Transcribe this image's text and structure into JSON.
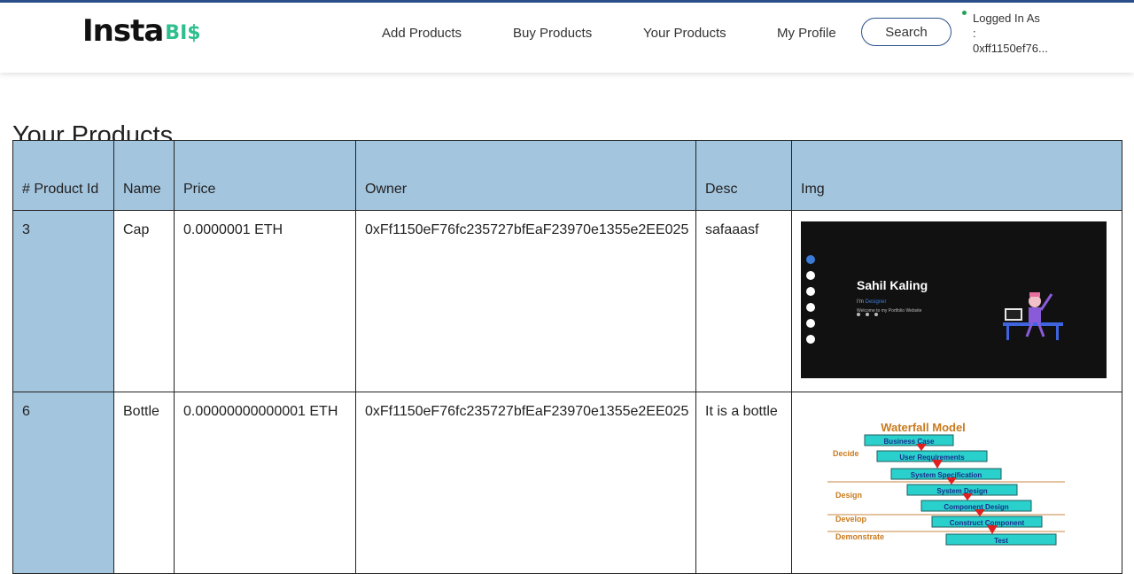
{
  "brand": {
    "main": "Insta",
    "sub": "BI$"
  },
  "nav": {
    "links": [
      "Add Products",
      "Buy Products",
      "Your Products",
      "My Profile"
    ],
    "search_label": "Search",
    "logged_in_lines": [
      "Logged In As",
      ":",
      "0xff1150ef76..."
    ]
  },
  "page": {
    "title": "Your Products"
  },
  "table": {
    "headers": [
      "# Product Id",
      "Name",
      "Price",
      "Owner",
      "Desc",
      "Img"
    ],
    "rows": [
      {
        "id": "3",
        "name": "Cap",
        "price": "0.0000001 ETH",
        "owner": "0xFf1150eF76fc235727bfEaF23970e1355e2EE025",
        "desc": "safaaasf"
      },
      {
        "id": "6",
        "name": "Bottle",
        "price": "0.00000000000001 ETH",
        "owner": "0xFf1150eF76fc235727bfEaF23970e1355e2EE025",
        "desc": "It is a bottle"
      }
    ]
  },
  "images": {
    "portfolio": {
      "name": "Sahil Kaling",
      "role_prefix": "I'm",
      "role": "Designer",
      "tagline": "Welcome to my Portfolio Website"
    },
    "waterfall": {
      "title": "Waterfall Model",
      "steps": [
        "Business Case",
        "User Requirements",
        "System Specification",
        "System Design",
        "Component Design",
        "Construct Component",
        "Test"
      ],
      "phases": [
        "Decide",
        "Design",
        "Develop",
        "Demonstrate"
      ]
    }
  },
  "colors": {
    "header_bg": "#a4c5de",
    "accent": "#2fbf8f",
    "nav_border": "#2b4f8c"
  }
}
